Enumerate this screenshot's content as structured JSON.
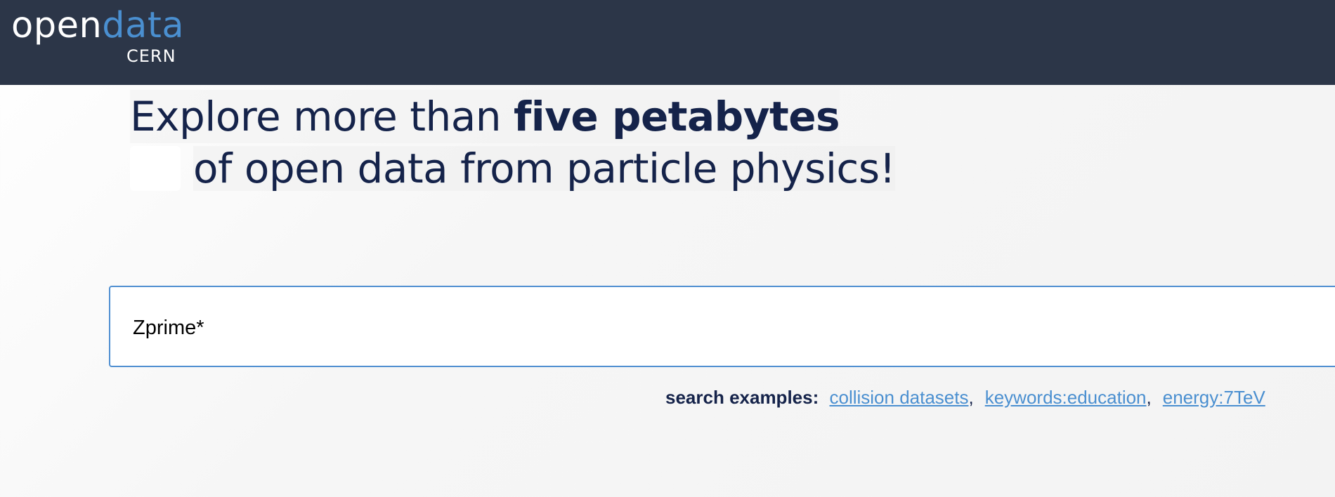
{
  "header": {
    "logo_open": "open",
    "logo_data": "data",
    "logo_sub": "CERN",
    "bg_color": "#2c3648",
    "accent_color": "#4a8fd0"
  },
  "hero": {
    "line1_prefix": "Explore more than ",
    "line1_strong": "five petabytes",
    "line2": "of open data from particle physics!"
  },
  "search": {
    "value": "Zprime*"
  },
  "examples": {
    "label": "search examples:",
    "links": [
      {
        "label": "collision datasets"
      },
      {
        "label": "keywords:education"
      },
      {
        "label": "energy:7TeV"
      }
    ],
    "separator": ","
  }
}
